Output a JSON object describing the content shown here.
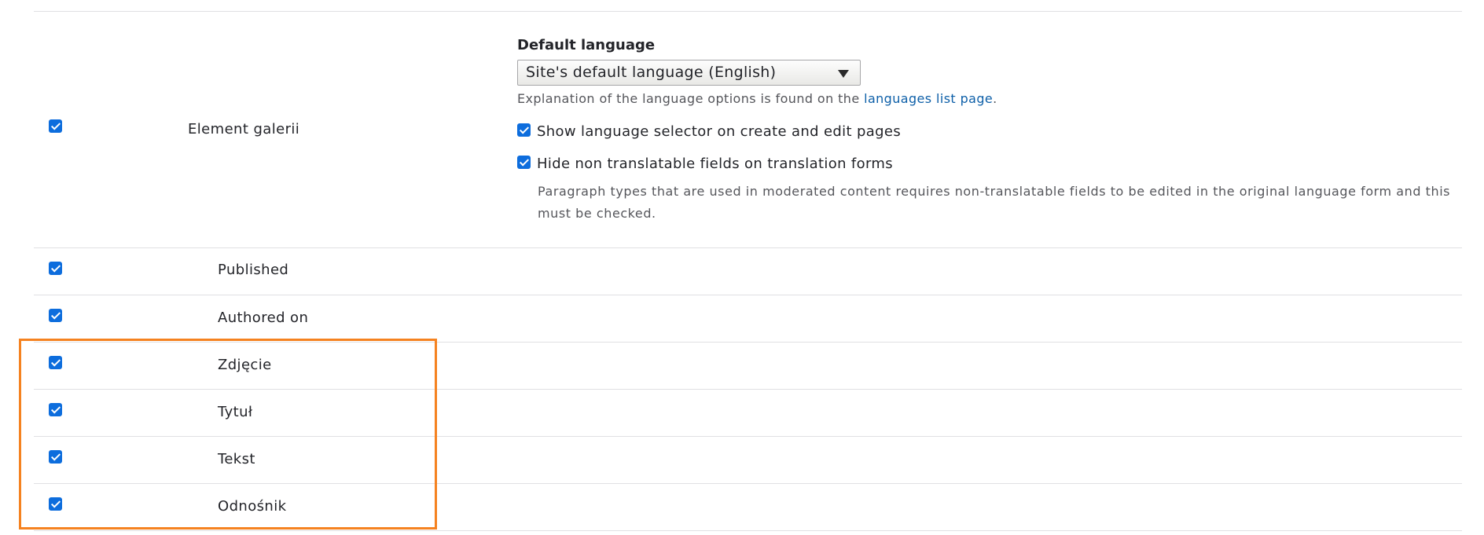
{
  "language_settings": {
    "title": "Default language",
    "select_value": "Site's default language (English)",
    "explanation_prefix": "Explanation of the language options is found on the ",
    "explanation_link": "languages list page",
    "explanation_suffix": ".",
    "show_selector": {
      "label": "Show language selector on create and edit pages",
      "checked": true
    },
    "hide_non_translatable": {
      "label": "Hide non translatable fields on translation forms",
      "checked": true,
      "description": "Paragraph types that are used in moderated content requires non-translatable fields to be edited in the original language form and this must be checked."
    }
  },
  "bundle_row": {
    "label": "Element galerii",
    "checked": true
  },
  "field_rows": [
    {
      "label": "Published",
      "checked": true
    },
    {
      "label": "Authored on",
      "checked": true
    },
    {
      "label": "Zdjęcie",
      "checked": true
    },
    {
      "label": "Tytuł",
      "checked": true
    },
    {
      "label": "Tekst",
      "checked": true
    },
    {
      "label": "Odnośnik",
      "checked": true
    }
  ],
  "colors": {
    "checkbox": "#0d6ddd",
    "link": "#0d5fa8",
    "highlight_border": "#f58220",
    "divider": "#e0e0e3"
  }
}
